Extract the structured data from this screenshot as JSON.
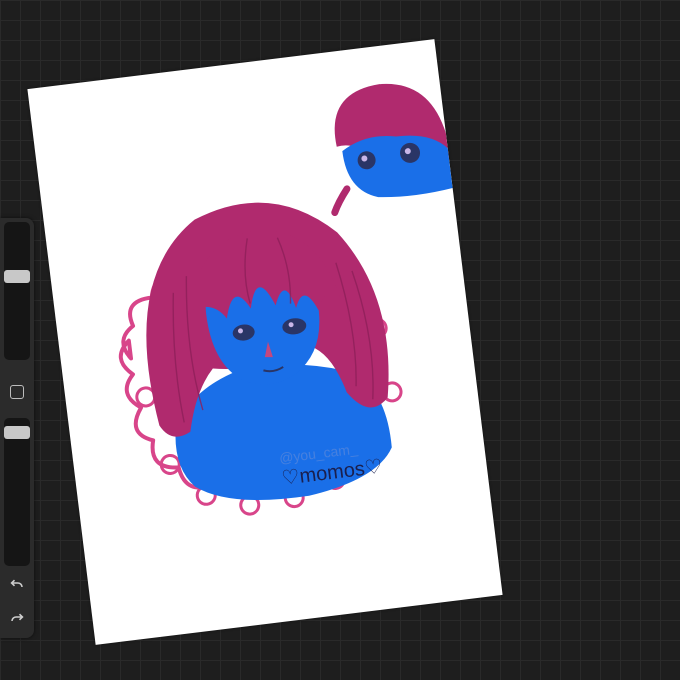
{
  "app": {
    "name": "Procreate-style drawing canvas"
  },
  "sidebar": {
    "brush_size": {
      "name": "brush-size",
      "level": 0.45
    },
    "brush_opacity": {
      "name": "brush-opacity",
      "level": 0.0
    },
    "modify_button": {
      "icon": "square-icon"
    },
    "undo_button": {
      "icon": "undo-icon"
    },
    "redo_button": {
      "icon": "redo-icon"
    }
  },
  "canvas": {
    "watermark_handle": "@you_cam_",
    "signature": "♡momos♡",
    "colors": {
      "hair": "#b02a6e",
      "skin": "#1a6fe8",
      "frame": "#d8458a",
      "background": "#ffffff"
    }
  }
}
